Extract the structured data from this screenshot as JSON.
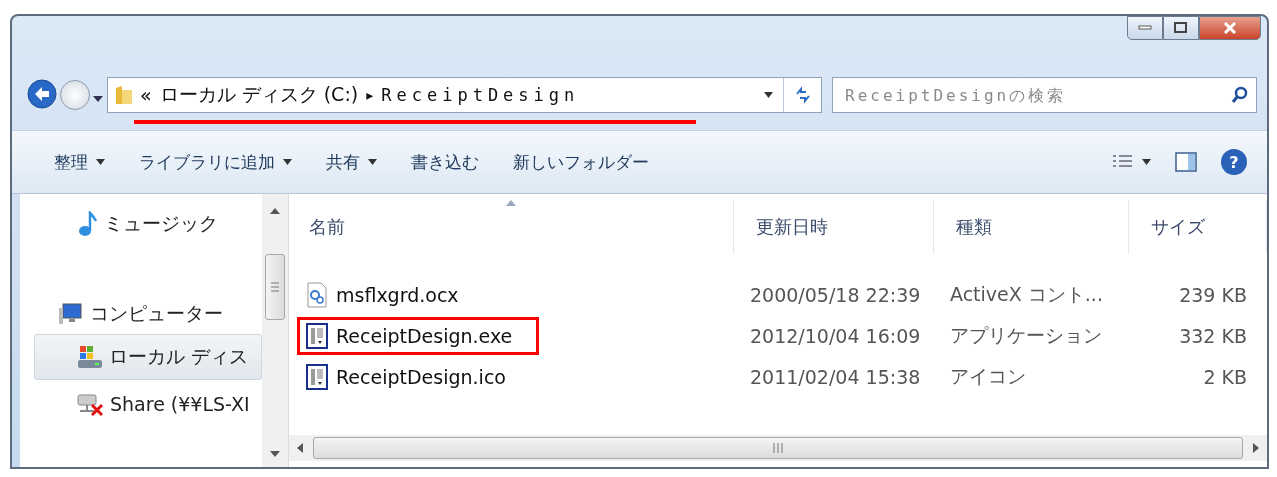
{
  "address": {
    "prefix": "«",
    "segments": [
      {
        "label": "ローカル ディスク (C:)"
      },
      {
        "label": "ReceiptDesign"
      }
    ],
    "separator": "▸",
    "underlined": true
  },
  "search": {
    "placeholder": "ReceiptDesignの検索"
  },
  "toolbar": [
    {
      "label": "整理",
      "has_menu": true
    },
    {
      "label": "ライブラリに追加",
      "has_menu": true
    },
    {
      "label": "共有",
      "has_menu": true
    },
    {
      "label": "書き込む",
      "has_menu": false
    },
    {
      "label": "新しいフォルダー",
      "has_menu": false
    }
  ],
  "help": {
    "label": "?"
  },
  "sidebar": {
    "items": [
      {
        "label": "ミュージック",
        "kind": "music",
        "selected": false
      },
      {
        "label": "コンピューター",
        "kind": "computer",
        "selected": false,
        "children": [
          {
            "label": "ローカル ディス",
            "kind": "drive",
            "selected": true
          },
          {
            "label": "Share (¥¥LS-XI",
            "kind": "share",
            "selected": false
          }
        ]
      }
    ]
  },
  "table": {
    "columns": [
      {
        "label": "名前",
        "sorted": true
      },
      {
        "label": "更新日時",
        "sorted": false
      },
      {
        "label": "種類",
        "sorted": false
      },
      {
        "label": "サイズ",
        "sorted": false
      }
    ],
    "rows": [
      {
        "name": "msflxgrd.ocx",
        "kind": "control",
        "modified": "2000/05/18 22:39",
        "type": "ActiveX コント...",
        "size": "239 KB",
        "annotated": false
      },
      {
        "name": "ReceiptDesign.exe",
        "kind": "app",
        "modified": "2012/10/04 16:09",
        "type": "アプリケーション",
        "size": "332 KB",
        "annotated": true
      },
      {
        "name": "ReceiptDesign.ico",
        "kind": "app",
        "modified": "2011/02/04 15:38",
        "type": "アイコン",
        "size": "2 KB",
        "annotated": false
      }
    ]
  }
}
